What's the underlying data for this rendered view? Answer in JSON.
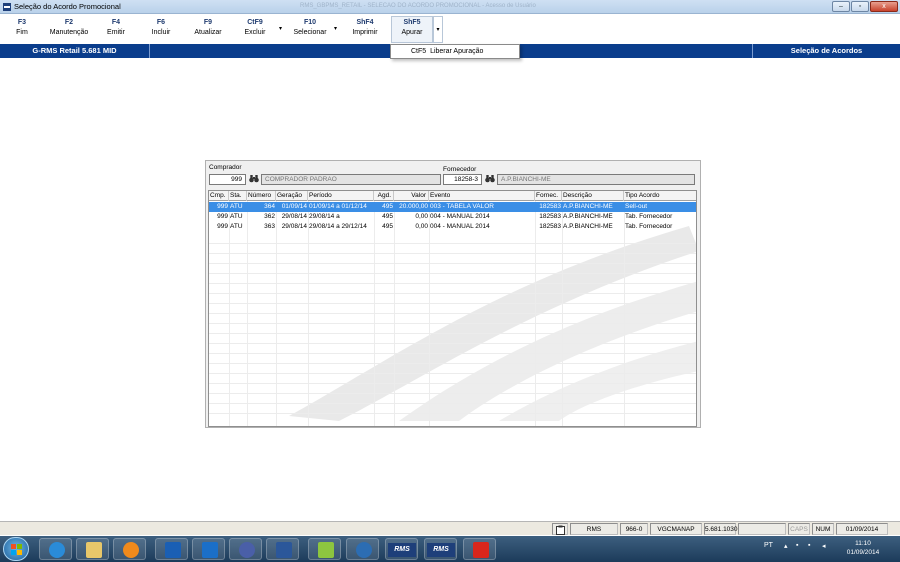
{
  "window": {
    "title": "Seleção do Acordo Promocional",
    "faded_caption": "RMS_GBPMS_RETAIL - SELECAO DO ACORDO PROMOCIONAL - Acesso de Usuário",
    "minimize": "–",
    "maximize": "▫",
    "close": "x"
  },
  "toolbar": {
    "items": [
      {
        "key": "F3",
        "label": "Fim"
      },
      {
        "key": "F2",
        "label": "Manutenção"
      },
      {
        "key": "F4",
        "label": "Emitir"
      },
      {
        "key": "F6",
        "label": "Incluir"
      },
      {
        "key": "F9",
        "label": "Atualizar"
      },
      {
        "key": "CtF9",
        "label": "Excluir"
      },
      {
        "key": "F10",
        "label": "Selecionar"
      },
      {
        "key": "ShF4",
        "label": "Imprimir"
      },
      {
        "key": "ShF5",
        "label": "Apurar"
      }
    ],
    "dropdown_glyph": "▾"
  },
  "header": {
    "left": "G-RMS Retail 5.681 MID",
    "right": "Seleção de Acordos"
  },
  "popup": {
    "key": "CtF5",
    "label": "Liberar Apuração"
  },
  "filters": {
    "comprador_label": "Comprador",
    "comprador_code": "999",
    "comprador_name": "COMPRADOR PADRAO",
    "fornecedor_label": "Fornecedor",
    "fornecedor_code": "18258-3",
    "fornecedor_name": "A.P.BIANCHI-ME",
    "lookup_icon": "binoculars-icon"
  },
  "table": {
    "columns": [
      "Cmp.",
      "Sta.",
      "Número",
      "Geração",
      "Período",
      "Agd.",
      "Valor",
      "Evento",
      "Fornec.",
      "Descrição",
      "Tipo Acordo"
    ],
    "rows": [
      [
        "999",
        "ATU",
        "364",
        "01/09/14",
        "01/09/14 a 01/12/14",
        "495",
        "20.000,00",
        "003 -  TABELA VALOR",
        "182583",
        "A.P.BIANCHI-ME",
        "Sell-out"
      ],
      [
        "999",
        "ATU",
        "362",
        "29/08/14",
        "29/08/14 a",
        "495",
        "0,00",
        "004 -  MANUAL 2014",
        "182583",
        "A.P.BIANCHI-ME",
        "Tab. Fornecedor"
      ],
      [
        "999",
        "ATU",
        "363",
        "29/08/14",
        "29/08/14 a 29/12/14",
        "495",
        "0,00",
        "004 -  MANUAL 2014",
        "182583",
        "A.P.BIANCHI-ME",
        "Tab. Fornecedor"
      ]
    ],
    "selected_row": 0
  },
  "statusbar": {
    "items": [
      "RMS",
      "966-0",
      "VGCMANAP",
      "5.681.1030",
      "",
      "CAPS",
      "NUM",
      "01/09/2014"
    ]
  },
  "taskbar": {
    "apps": [
      "internet-explorer-icon",
      "file-explorer-icon",
      "media-player-icon",
      "outlook-icon",
      "lync-icon",
      "app-icon",
      "word-icon",
      "app-icon",
      "app-icon",
      "rms-icon",
      "rms-icon",
      "acrobat-icon"
    ],
    "rms_label": "RMS",
    "lang": "PT",
    "time": "11:10",
    "date": "01/09/2014"
  },
  "colors": {
    "header_blue": "#0a3d8c",
    "selection_blue": "#3a8ee6",
    "key_text": "#1e3a6e"
  }
}
